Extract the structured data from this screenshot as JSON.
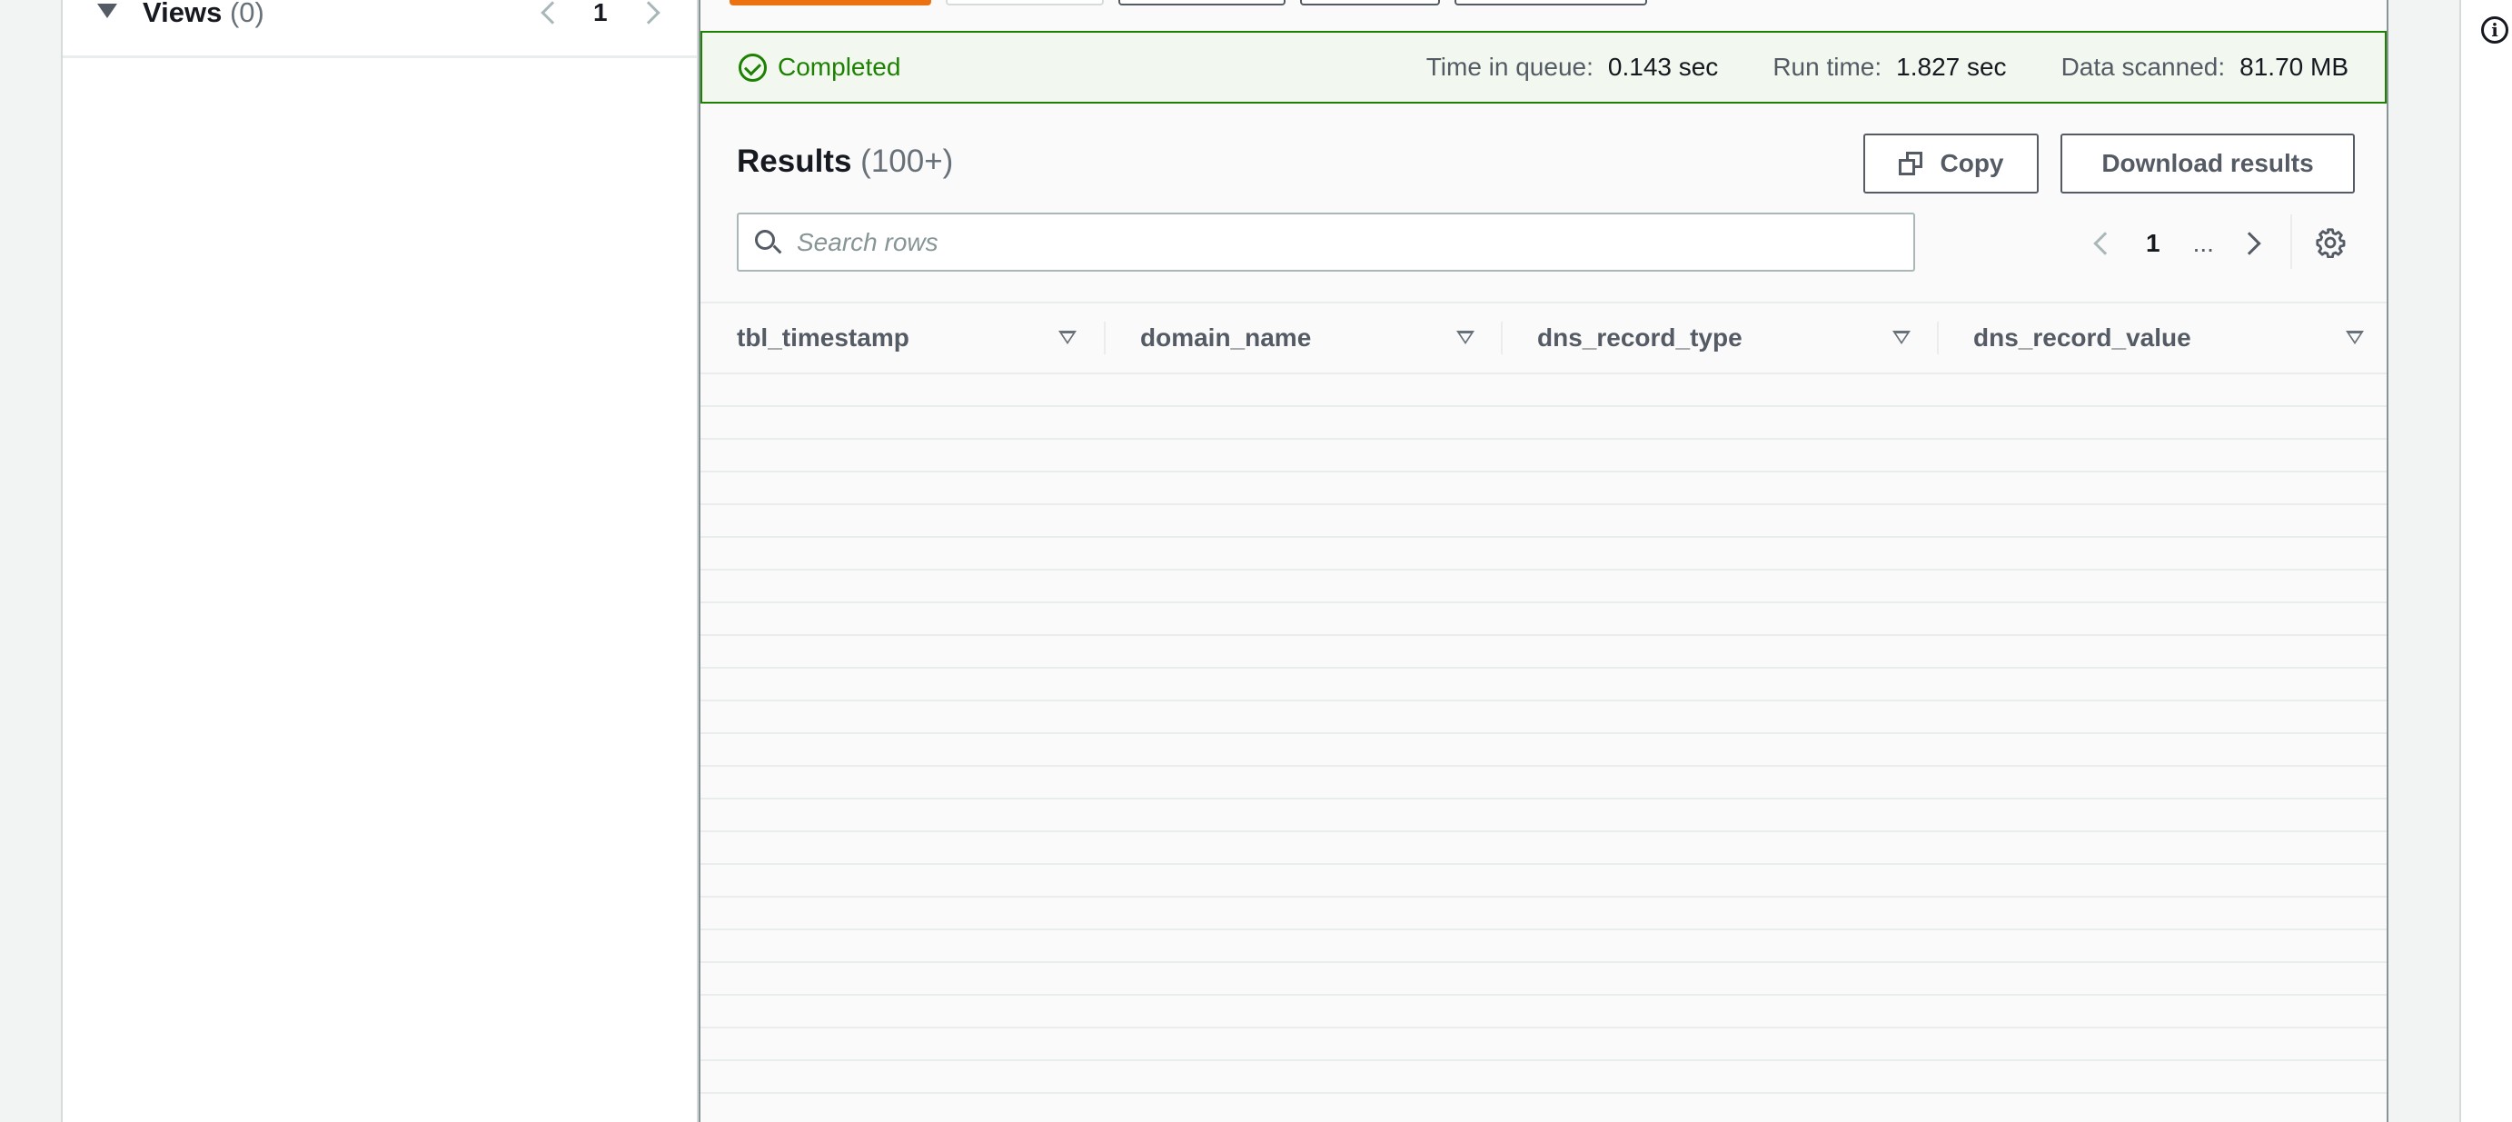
{
  "views_panel": {
    "title": "Views",
    "count": "(0)",
    "page": "1"
  },
  "status": {
    "state": "Completed",
    "time_in_queue_label": "Time in queue:",
    "time_in_queue_value": "0.143 sec",
    "run_time_label": "Run time:",
    "run_time_value": "1.827 sec",
    "data_scanned_label": "Data scanned:",
    "data_scanned_value": "81.70 MB"
  },
  "results": {
    "title": "Results",
    "count": "(100+)",
    "copy_label": "Copy",
    "download_label": "Download results",
    "search_placeholder": "Search rows",
    "page": "1",
    "ellipsis": "..."
  },
  "table": {
    "columns": [
      "tbl_timestamp",
      "domain_name",
      "dns_record_type",
      "dns_record_value"
    ],
    "rows": []
  },
  "colors": {
    "success": "#1d8102",
    "primary": "#ec7211",
    "border": "#545b64"
  }
}
